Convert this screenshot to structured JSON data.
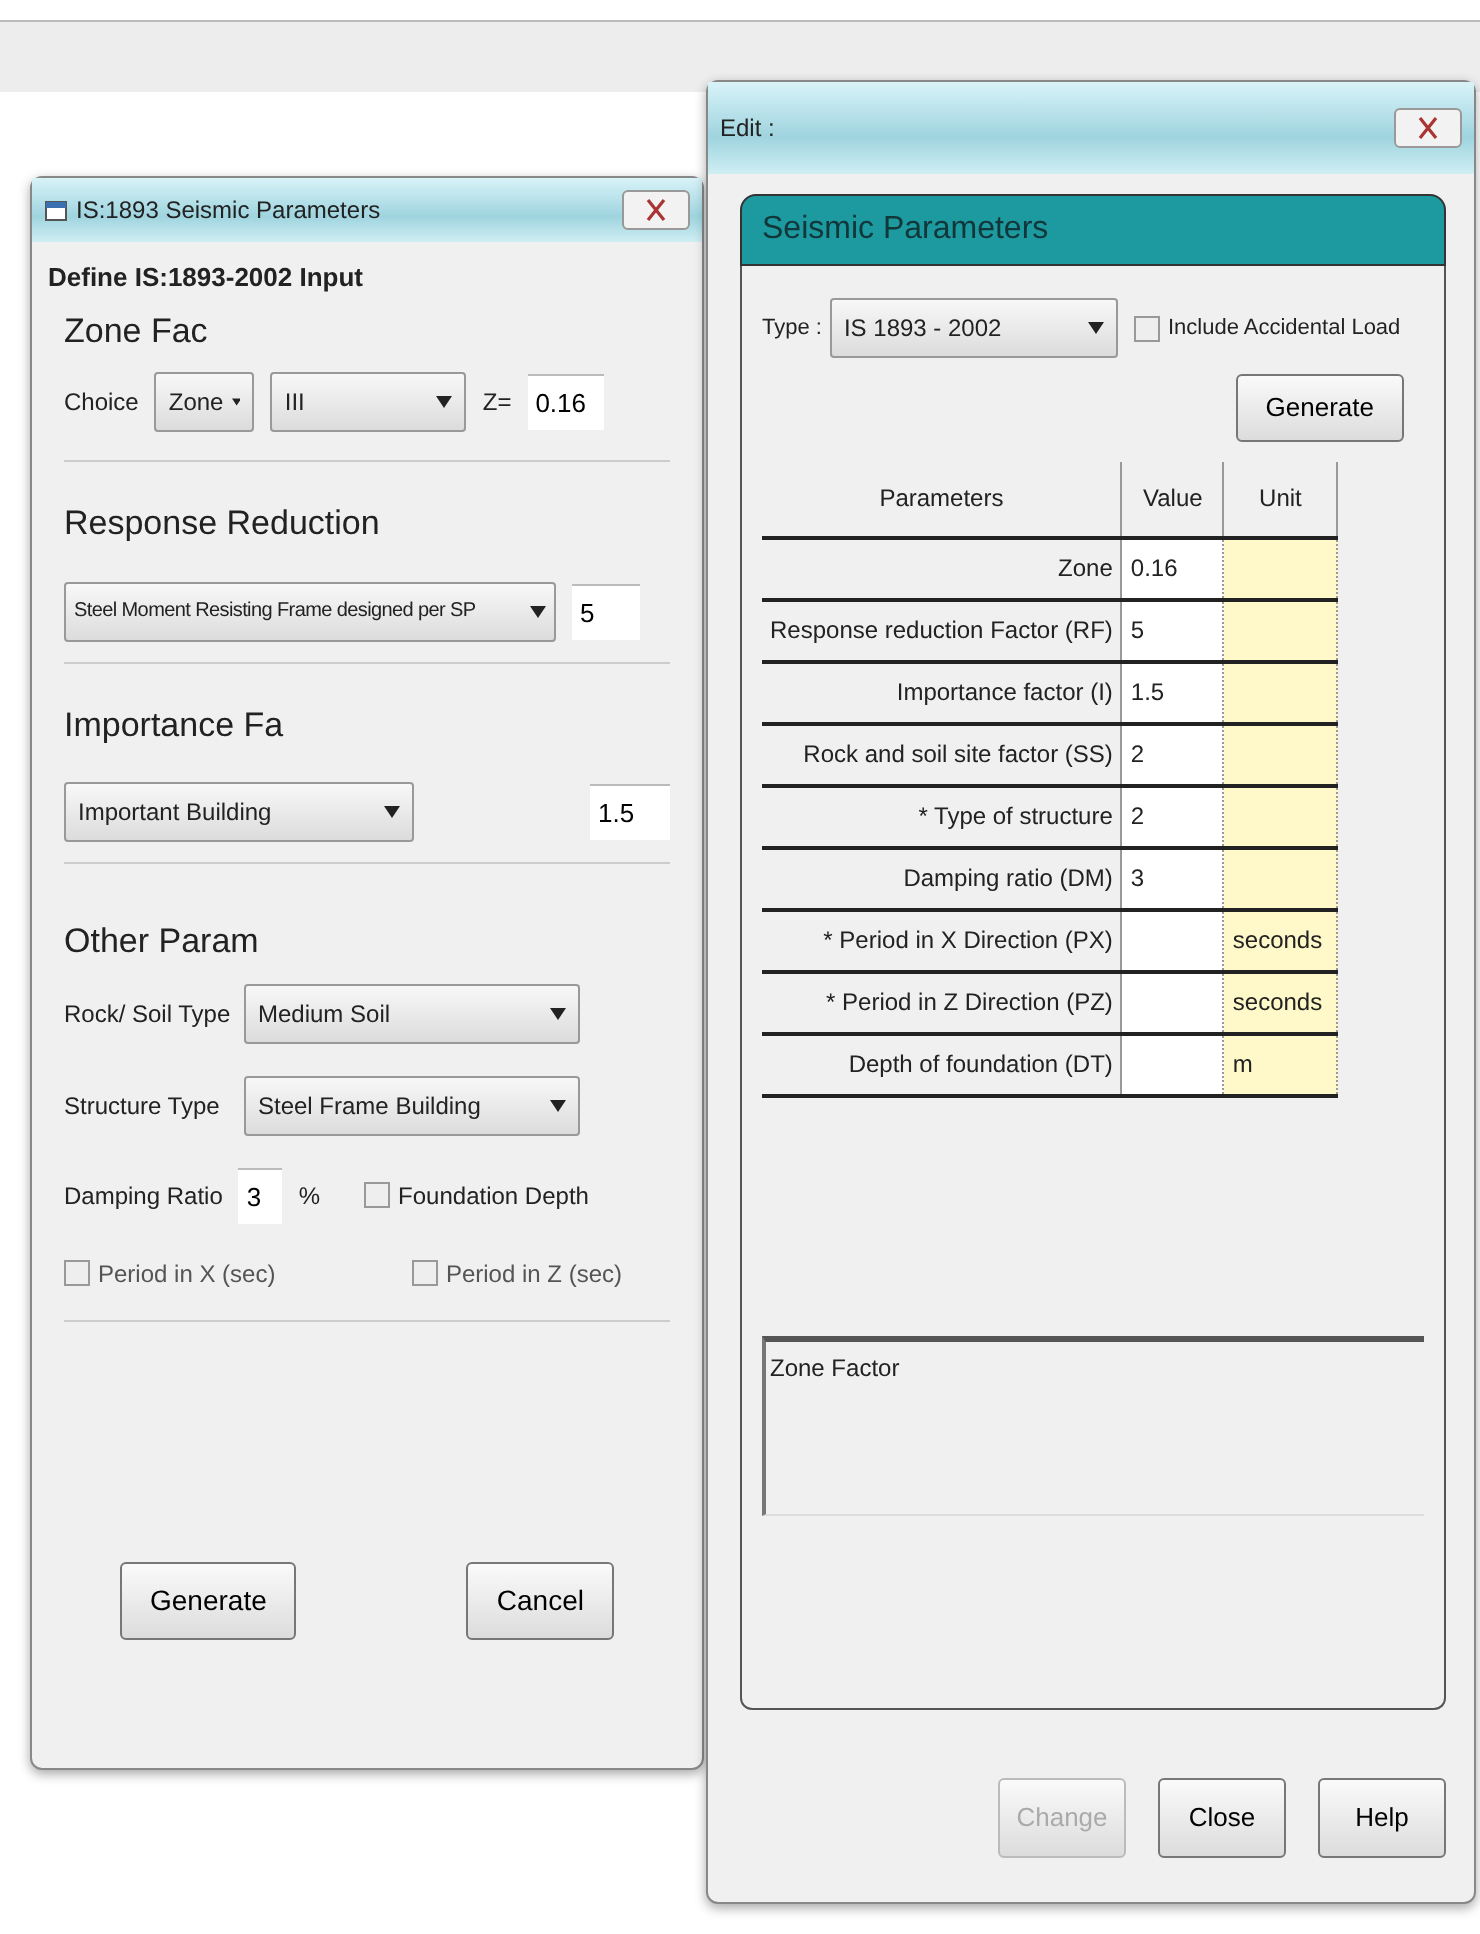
{
  "left_window": {
    "title": "IS:1893 Seismic Parameters",
    "heading": "Define IS:1893-2002 Input",
    "zone_group": {
      "title": "Zone Fac",
      "choice_label": "Choice",
      "choice_value": "Zone",
      "zone_value": "III",
      "z_label": "Z=",
      "z_value": "0.16"
    },
    "response_group": {
      "title": "Response Reduction",
      "frame_type": "Steel Moment Resisting Frame designed per SP",
      "rf_value": "5"
    },
    "importance_group": {
      "title": "Importance Fa",
      "building_type": "Important Building",
      "value": "1.5"
    },
    "other_group": {
      "title": "Other Param",
      "soil_label": "Rock/ Soil Type",
      "soil_value": "Medium Soil",
      "structure_label": "Structure Type",
      "structure_value": "Steel Frame Building",
      "damping_label": "Damping Ratio",
      "damping_value": "3",
      "damping_unit": "%",
      "checkboxes": [
        {
          "label": "Foundation Depth",
          "checked": false
        },
        {
          "label": "Period in X (sec)",
          "checked": false
        },
        {
          "label": "Period in Z (sec)",
          "checked": false
        }
      ]
    },
    "buttons": [
      "Generate",
      "Cancel"
    ]
  },
  "right_window": {
    "title": "Edit :",
    "header": "Seismic Parameters",
    "type_label": "Type :",
    "type_value": "IS 1893 - 2002",
    "include_checkbox": {
      "label": "Include Accidental Load",
      "checked": false
    },
    "generate_button": "Generate",
    "table": {
      "columns": [
        "Parameters",
        "Value",
        "Unit"
      ],
      "rows": [
        {
          "parameter": "Zone",
          "value": "0.16",
          "unit": ""
        },
        {
          "parameter": "Response reduction Factor (RF)",
          "value": "5",
          "unit": ""
        },
        {
          "parameter": "Importance factor (I)",
          "value": "1.5",
          "unit": ""
        },
        {
          "parameter": "Rock and soil site factor (SS)",
          "value": "2",
          "unit": ""
        },
        {
          "parameter": "* Type of structure",
          "value": "2",
          "unit": ""
        },
        {
          "parameter": "Damping ratio (DM)",
          "value": "3",
          "unit": ""
        },
        {
          "parameter": "* Period in X Direction (PX)",
          "value": "",
          "unit": "seconds"
        },
        {
          "parameter": "* Period in Z Direction (PZ)",
          "value": "",
          "unit": "seconds"
        },
        {
          "parameter": "Depth of foundation (DT)",
          "value": "",
          "unit": "m"
        }
      ]
    },
    "description": "Zone Factor",
    "buttons": [
      {
        "label": "Change",
        "disabled": true
      },
      {
        "label": "Close",
        "disabled": false
      },
      {
        "label": "Help",
        "disabled": false
      }
    ]
  }
}
